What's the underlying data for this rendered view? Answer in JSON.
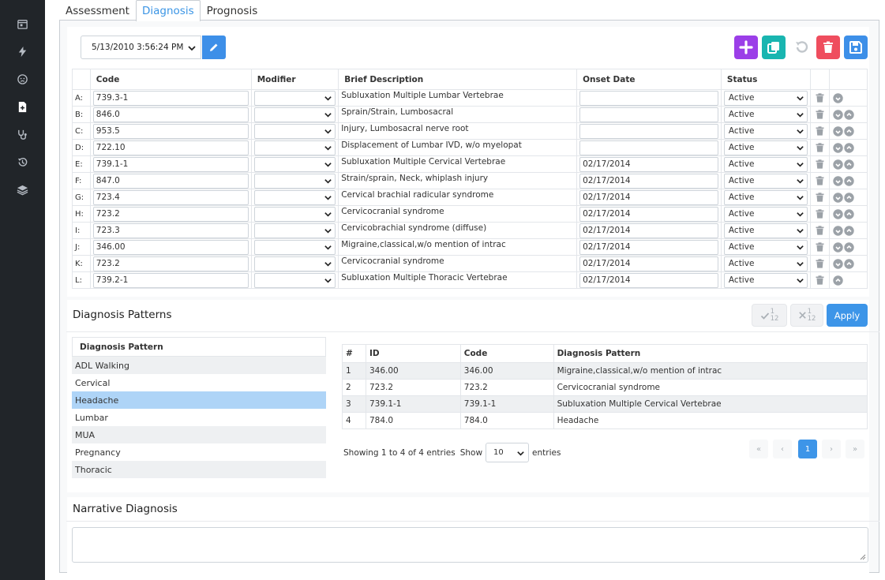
{
  "sidebar": {
    "items": [
      {
        "icon": "calendar-icon"
      },
      {
        "icon": "bolt-icon"
      },
      {
        "icon": "face-icon"
      },
      {
        "icon": "file-plus-icon",
        "active": true
      },
      {
        "icon": "stethoscope-icon"
      },
      {
        "icon": "history-icon"
      },
      {
        "icon": "layers-icon"
      }
    ]
  },
  "tabs": [
    {
      "label": "Assessment",
      "active": false
    },
    {
      "label": "Diagnosis",
      "active": true
    },
    {
      "label": "Prognosis",
      "active": false
    }
  ],
  "toolbar": {
    "date_value": "5/13/2010 3:56:24 PM",
    "colors": {
      "add": "#9b3ee8",
      "copy": "#19b5b0",
      "undo": "#cfd3d7",
      "delete": "#ef4d5e",
      "save": "#3d8fe8",
      "edit": "#3d8fe8"
    }
  },
  "diagnosis_table": {
    "headers": [
      "Code",
      "Modifier",
      "Brief Description",
      "Onset Date",
      "Status"
    ],
    "rows": [
      {
        "label": "A:",
        "code": "739.3-1",
        "desc": "Subluxation Multiple Lumbar Vertebrae",
        "onset": "",
        "status": "Active",
        "down": true,
        "up": false
      },
      {
        "label": "B:",
        "code": "846.0",
        "desc": "Sprain/Strain, Lumbosacral",
        "onset": "",
        "status": "Active",
        "down": true,
        "up": true
      },
      {
        "label": "C:",
        "code": "953.5",
        "desc": "Injury, Lumbosacral nerve root",
        "onset": "",
        "status": "Active",
        "down": true,
        "up": true
      },
      {
        "label": "D:",
        "code": "722.10",
        "desc": "Displacement of Lumbar IVD, w/o myelopat",
        "onset": "",
        "status": "Active",
        "down": true,
        "up": true
      },
      {
        "label": "E:",
        "code": "739.1-1",
        "desc": "Subluxation Multiple Cervical Vertebrae",
        "onset": "02/17/2014",
        "status": "Active",
        "down": true,
        "up": true
      },
      {
        "label": "F:",
        "code": "847.0",
        "desc": "Strain/sprain, Neck, whiplash injury",
        "onset": "02/17/2014",
        "status": "Active",
        "down": true,
        "up": true
      },
      {
        "label": "G:",
        "code": "723.4",
        "desc": "Cervical brachial radicular syndrome",
        "onset": "02/17/2014",
        "status": "Active",
        "down": true,
        "up": true
      },
      {
        "label": "H:",
        "code": "723.2",
        "desc": "Cervicocranial syndrome",
        "onset": "02/17/2014",
        "status": "Active",
        "down": true,
        "up": true
      },
      {
        "label": "I:",
        "code": "723.3",
        "desc": "Cervicobrachial syndrome (diffuse)",
        "onset": "02/17/2014",
        "status": "Active",
        "down": true,
        "up": true
      },
      {
        "label": "J:",
        "code": "346.00",
        "desc": "Migraine,classical,w/o mention of intrac",
        "onset": "02/17/2014",
        "status": "Active",
        "down": true,
        "up": true
      },
      {
        "label": "K:",
        "code": "723.2",
        "desc": "Cervicocranial syndrome",
        "onset": "02/17/2014",
        "status": "Active",
        "down": true,
        "up": true
      },
      {
        "label": "L:",
        "code": "739.2-1",
        "desc": "Subluxation Multiple Thoracic Vertebrae",
        "onset": "02/17/2014",
        "status": "Active",
        "down": false,
        "up": true
      }
    ]
  },
  "patterns": {
    "title": "Diagnosis Patterns",
    "check_label_top": "1",
    "check_label_bottom": "12",
    "uncheck_label_top": "1",
    "uncheck_label_bottom": "12",
    "apply_label": "Apply",
    "list_header": "Diagnosis Pattern",
    "list": [
      {
        "name": "ADL Walking",
        "selected": false
      },
      {
        "name": "Cervical",
        "selected": false
      },
      {
        "name": "Headache",
        "selected": true
      },
      {
        "name": "Lumbar",
        "selected": false
      },
      {
        "name": "MUA",
        "selected": false
      },
      {
        "name": "Pregnancy",
        "selected": false
      },
      {
        "name": "Thoracic",
        "selected": false
      }
    ],
    "detail_headers": [
      "#",
      "ID",
      "Code",
      "Diagnosis Pattern"
    ],
    "detail_rows": [
      [
        "1",
        "346.00",
        "346.00",
        "Migraine,classical,w/o mention of intrac"
      ],
      [
        "2",
        "723.2",
        "723.2",
        "Cervicocranial syndrome"
      ],
      [
        "3",
        "739.1-1",
        "739.1-1",
        "Subluxation Multiple Cervical Vertebrae"
      ],
      [
        "4",
        "784.0",
        "784.0",
        "Headache"
      ]
    ],
    "showing_text": "Showing 1 to 4 of 4 entries",
    "show_label": "Show",
    "page_size": "10",
    "entries_label": "entries",
    "pager": {
      "first": "«",
      "prev": "‹",
      "current": "1",
      "next": "›",
      "last": "»"
    }
  },
  "narrative": {
    "title": "Narrative Diagnosis",
    "value": ""
  }
}
